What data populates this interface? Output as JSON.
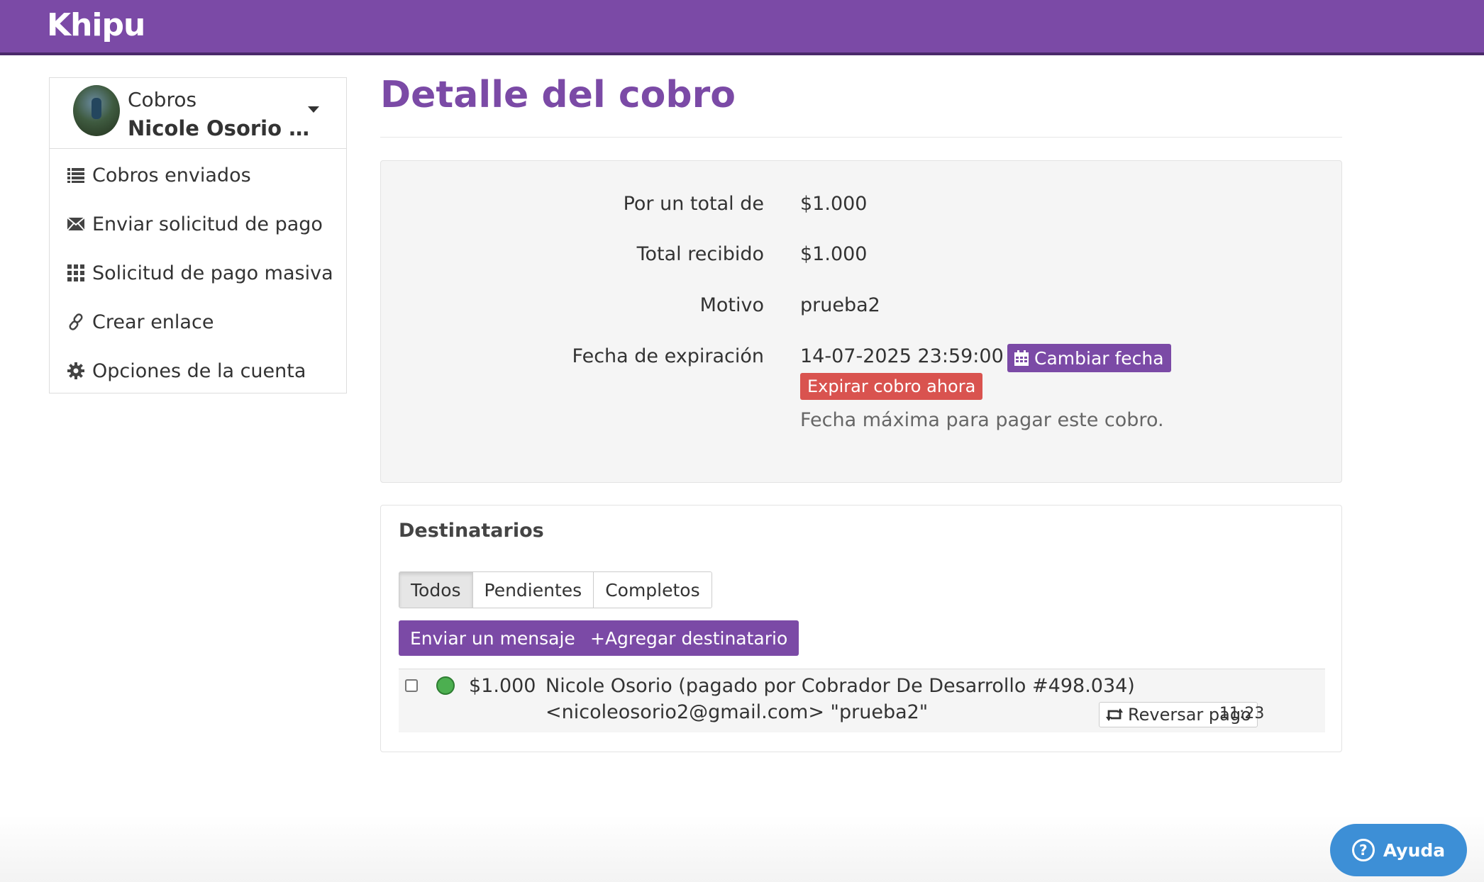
{
  "brand": {
    "logo_text": "Khipu",
    "color": "#7b4aa6"
  },
  "sidebar": {
    "account_title": "Cobros",
    "account_name": "Nicole Osorio Rodríguez",
    "items": [
      {
        "label": "Cobros enviados",
        "icon": "list-icon"
      },
      {
        "label": "Enviar solicitud de pago",
        "icon": "envelope-icon"
      },
      {
        "label": "Solicitud de pago masiva",
        "icon": "grid-icon"
      },
      {
        "label": "Crear enlace",
        "icon": "link-icon"
      },
      {
        "label": "Opciones de la cuenta",
        "icon": "gear-icon"
      }
    ]
  },
  "main": {
    "title": "Detalle del cobro",
    "summary": {
      "total_label": "Por un total de",
      "total_value": "$1.000",
      "received_label": "Total recibido",
      "received_value": "$1.000",
      "reason_label": "Motivo",
      "reason_value": "prueba2",
      "expiry_label": "Fecha de expiración",
      "expiry_value": "14-07-2025 23:59:00",
      "change_date_button": "Cambiar fecha",
      "expire_now_button": "Expirar cobro ahora",
      "expiry_help": "Fecha máxima para pagar este cobro."
    },
    "recipients": {
      "title": "Destinatarios",
      "tabs": [
        "Todos",
        "Pendientes",
        "Completos"
      ],
      "active_tab": "Todos",
      "send_message_button": "Enviar un mensaje",
      "add_recipient_button": "+Agregar destinatario",
      "rows": [
        {
          "status_color": "#4caf50",
          "amount": "$1.000",
          "line1": "Nicole Osorio (pagado por Cobrador De Desarrollo #498.034)",
          "line2": "<nicoleosorio2@gmail.com> \"prueba2\"",
          "action": "Reversar pago",
          "time": "11:23"
        }
      ]
    }
  },
  "help_button": "Ayuda"
}
